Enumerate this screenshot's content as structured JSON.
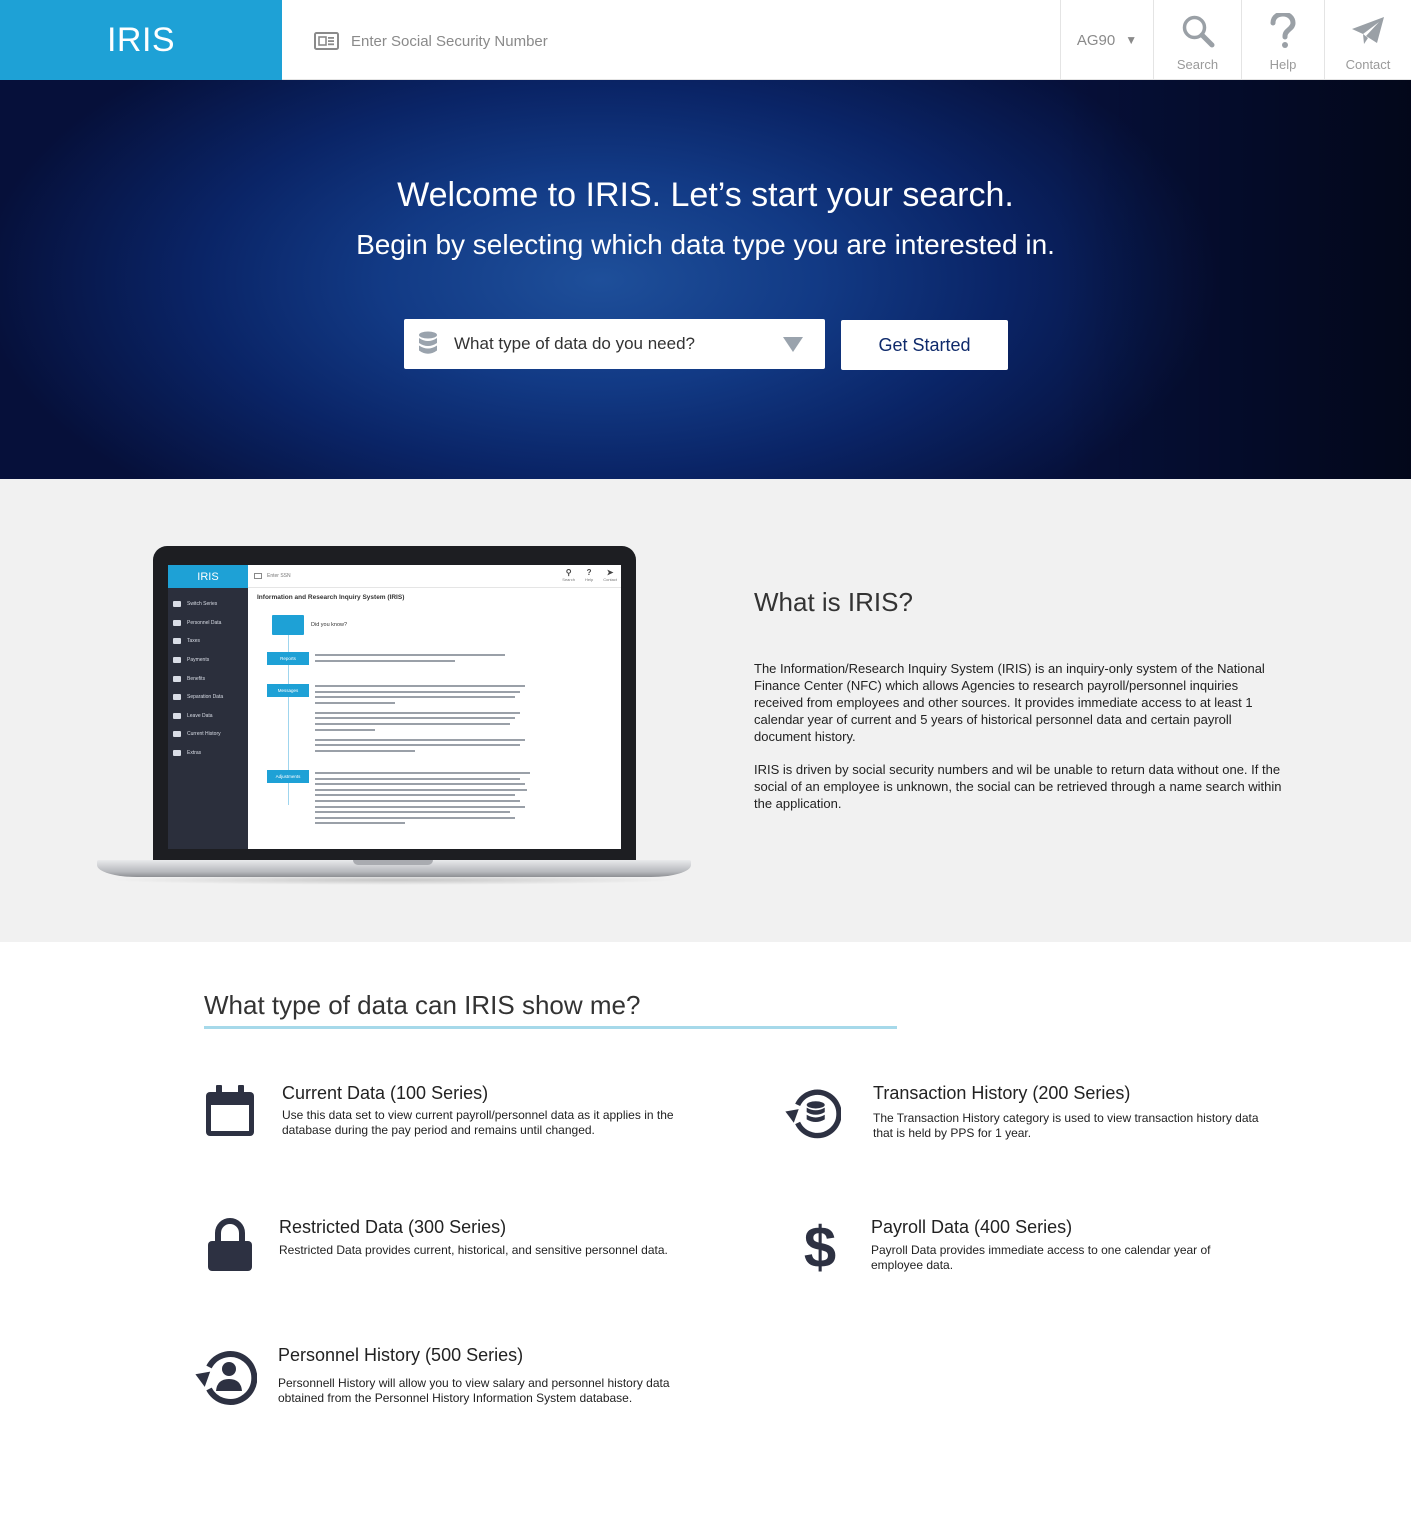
{
  "header": {
    "brand": "IRIS",
    "ssn_placeholder": "Enter Social Security Number",
    "agency": "AG90",
    "nav": [
      {
        "label": "Search",
        "icon": "search-icon"
      },
      {
        "label": "Help",
        "icon": "help-icon"
      },
      {
        "label": "Contact",
        "icon": "paper-plane-icon"
      }
    ]
  },
  "hero": {
    "title": "Welcome to IRIS. Let’s start your search.",
    "subtitle": "Begin by selecting which data type you are interested in.",
    "select_placeholder": "What type of data do you need?",
    "cta": "Get Started"
  },
  "about": {
    "heading": "What is IRIS?",
    "paragraph1": "The Information/Research Inquiry System (IRIS) is an inquiry-only system of the National Finance Center (NFC) which allows Agencies to research payroll/personnel inquiries received from employees and other sources. It provides immediate access to at least 1 calendar year of current and 5 years of historical personnel data and certain payroll document history.",
    "paragraph2": "IRIS is driven by social security numbers and wil be unable to return data without one. If the social of an employee is unknown, the social can be retrieved through a name search within the application.",
    "mockup": {
      "brand": "IRIS",
      "ssn": "Enter SSN",
      "icons": [
        "Search",
        "Help",
        "Contact"
      ],
      "title": "Information and Research Inquiry System (IRIS)",
      "did_you_know": "Did you know?",
      "menu": [
        "Switch Series",
        "Personnel Data",
        "Taxes",
        "Payments",
        "Benefits",
        "Separation Data",
        "Leave Data",
        "Current History",
        "Extras"
      ],
      "tags": [
        "Reports",
        "Messages",
        "Adjustments"
      ]
    }
  },
  "types": {
    "heading": "What type of data can IRIS show me?",
    "items": [
      {
        "title": "Current Data (100 Series)",
        "desc": "Use this data set to view current payroll/personnel data as it applies in the database during the pay period and remains until changed.",
        "icon": "calendar-icon"
      },
      {
        "title": "Transaction History (200 Series)",
        "desc": "The Transaction History category is used to view transaction history data that is held by PPS for 1 year.",
        "icon": "database-history-icon"
      },
      {
        "title": "Restricted Data (300 Series)",
        "desc": "Restricted Data provides current, historical, and sensitive personnel data.",
        "icon": "lock-icon"
      },
      {
        "title": "Payroll Data (400 Series)",
        "desc": "Payroll Data provides immediate access to one calendar year of employee data.",
        "icon": "dollar-icon"
      },
      {
        "title": "Personnel History (500 Series)",
        "desc": "Personnell History will allow you to view salary and personnel history data obtained from the Personnel History Information System database.",
        "icon": "user-history-icon"
      }
    ]
  }
}
